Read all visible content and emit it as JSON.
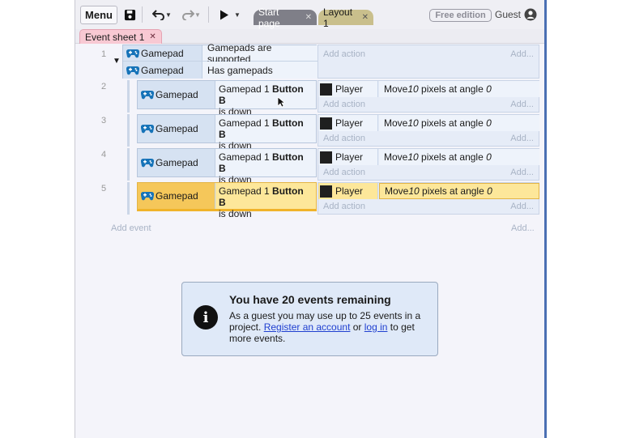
{
  "toolbar": {
    "menu_label": "Menu",
    "tabs": [
      {
        "label": "Start page"
      },
      {
        "label": "Layout 1"
      }
    ],
    "free_edition_label": "Free edition",
    "guest_label": "Guest"
  },
  "sheet_tab": {
    "label": "Event sheet 1"
  },
  "block1": {
    "number": "1",
    "conditions": [
      {
        "object": "Gamepad",
        "text": "Gamepads are supported"
      },
      {
        "object": "Gamepad",
        "text": "Has gamepads"
      }
    ],
    "add_action": "Add action",
    "add_right": "Add..."
  },
  "subevents": [
    {
      "number": "2",
      "object": "Gamepad",
      "cond_pre": "Gamepad 1 ",
      "cond_bold": "Button B",
      "cond_post": "is down",
      "action_object": "Player",
      "action_pre": "Move ",
      "action_num": "10",
      "action_mid": " pixels at angle ",
      "action_angle": "0",
      "add_action": "Add action",
      "add_right": "Add..."
    },
    {
      "number": "3",
      "object": "Gamepad",
      "cond_pre": "Gamepad 1 ",
      "cond_bold": "Button B",
      "cond_post": "is down",
      "action_object": "Player",
      "action_pre": "Move ",
      "action_num": "10",
      "action_mid": " pixels at angle ",
      "action_angle": "0",
      "add_action": "Add action",
      "add_right": "Add..."
    },
    {
      "number": "4",
      "object": "Gamepad",
      "cond_pre": "Gamepad 1 ",
      "cond_bold": "Button B",
      "cond_post": "is down",
      "action_object": "Player",
      "action_pre": "Move ",
      "action_num": "10",
      "action_mid": " pixels at angle ",
      "action_angle": "0",
      "add_action": "Add action",
      "add_right": "Add..."
    },
    {
      "number": "5",
      "object": "Gamepad",
      "cond_pre": "Gamepad 1 ",
      "cond_bold": "Button B",
      "cond_post": "is down",
      "action_object": "Player",
      "action_pre": "Move ",
      "action_num": "10",
      "action_mid": " pixels at angle ",
      "action_angle": "0",
      "add_action": "Add action",
      "add_right": "Add..."
    }
  ],
  "add_event": "Add event",
  "add_event_right": "Add...",
  "notice": {
    "title": "You have 20 events remaining",
    "line1": "As a guest you may use up to 25 events in a project. ",
    "register_link": "Register an account",
    "or": " or ",
    "login_link": "log in",
    "line2": " to get more events."
  },
  "colors": {
    "selected_row": "#fde79a",
    "selected_condition": "#f5c75a",
    "condition_object": "#d6e2f2",
    "sheet_tab": "#f8c9d3",
    "link": "#1f3fd0"
  }
}
